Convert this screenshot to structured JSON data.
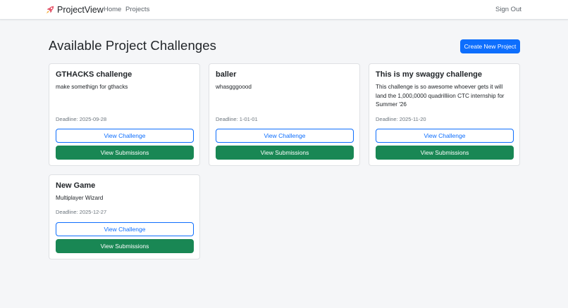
{
  "nav": {
    "brand": "ProjectView",
    "brand_icon": "rocket-icon",
    "links": [
      "Home",
      "Projects"
    ],
    "sign_out": "Sign Out"
  },
  "page": {
    "title": "Available Project Challenges",
    "create_button": "Create New Project"
  },
  "challenges": [
    {
      "title": "GTHACKS challenge",
      "description": "make somethign for gthacks",
      "deadline": "Deadline: 2025-09-28",
      "view_label": "View Challenge",
      "submissions_label": "View Submissions"
    },
    {
      "title": "baller",
      "description": "whasgggoood",
      "deadline": "Deadline: 1-01-01",
      "view_label": "View Challenge",
      "submissions_label": "View Submissions"
    },
    {
      "title": "This is my swaggy challenge",
      "description": "This challenge is so awesome whoever gets it will land the 1,000,0000 quadrilliion CTC internship for Summer '26",
      "deadline": "Deadline: 2025-11-20",
      "view_label": "View Challenge",
      "submissions_label": "View Submissions"
    },
    {
      "title": "New Game",
      "description": "Multiplayer Wizard",
      "deadline": "Deadline: 2025-12-27",
      "view_label": "View Challenge",
      "submissions_label": "View Submissions"
    }
  ],
  "colors": {
    "primary": "#0d6efd",
    "success": "#198754",
    "background": "#f5f6f8"
  }
}
